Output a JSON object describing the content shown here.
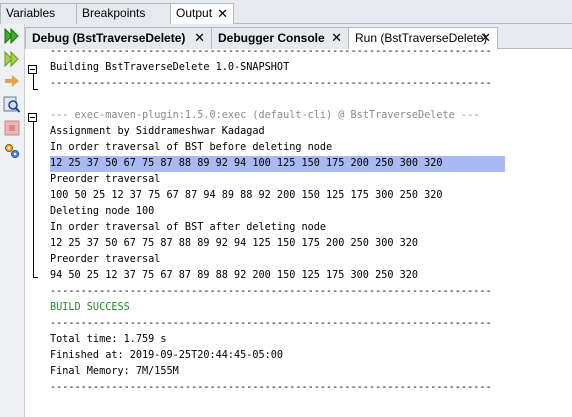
{
  "top_tabs": [
    {
      "label": "Variables",
      "closable": false
    },
    {
      "label": "Breakpoints",
      "closable": false
    },
    {
      "label": "Output",
      "closable": true,
      "active": true
    }
  ],
  "sub_tabs": [
    {
      "label": "Debug (BstTraverseDelete)",
      "bold": true
    },
    {
      "label": "Debugger Console",
      "bold": true
    },
    {
      "label": "Run (BstTraverseDelete)",
      "active": true
    }
  ],
  "close_glyph": "✕",
  "toolbar": [
    "rerun-icon",
    "rerun-options-icon",
    "stop-arrow-icon",
    "find-icon",
    "stop-icon",
    "settings-icon"
  ],
  "output": {
    "rule": "------------------------------------------------------------------------",
    "building": "Building BstTraverseDelete 1.0-SNAPSHOT",
    "exec": "--- exec-maven-plugin:1.5.0:exec (default-cli) @ BstTraverseDelete ---",
    "lines": [
      "Assignment by Siddrameshwar Kadagad",
      "In order traversal of BST before deleting node",
      "12 25 37 50 67 75 87 88 89 92 94 100 125 150 175 200 250 300 320",
      "Preorder traversal",
      "100 50 25 12 37 75 67 87 94 89 88 92 200 150 125 175 300 250 320",
      "Deleting node 100",
      "In order traversal of BST after deleting node",
      "12 25 37 50 67 75 87 88 89 92 94 125 150 175 200 250 300 320",
      "Preorder traversal",
      "94 50 25 12 37 75 67 87 89 88 92 200 150 125 175 300 250 320"
    ],
    "build_success": "BUILD SUCCESS",
    "total_time": "Total time: 1.759 s",
    "finished_at": "Finished at: 2019-09-25T20:44:45-05:00",
    "final_memory": "Final Memory: 7M/155M"
  },
  "colors": {
    "highlight": "#a9b9f1",
    "success": "#238b23",
    "muted": "#8a8a8a"
  }
}
